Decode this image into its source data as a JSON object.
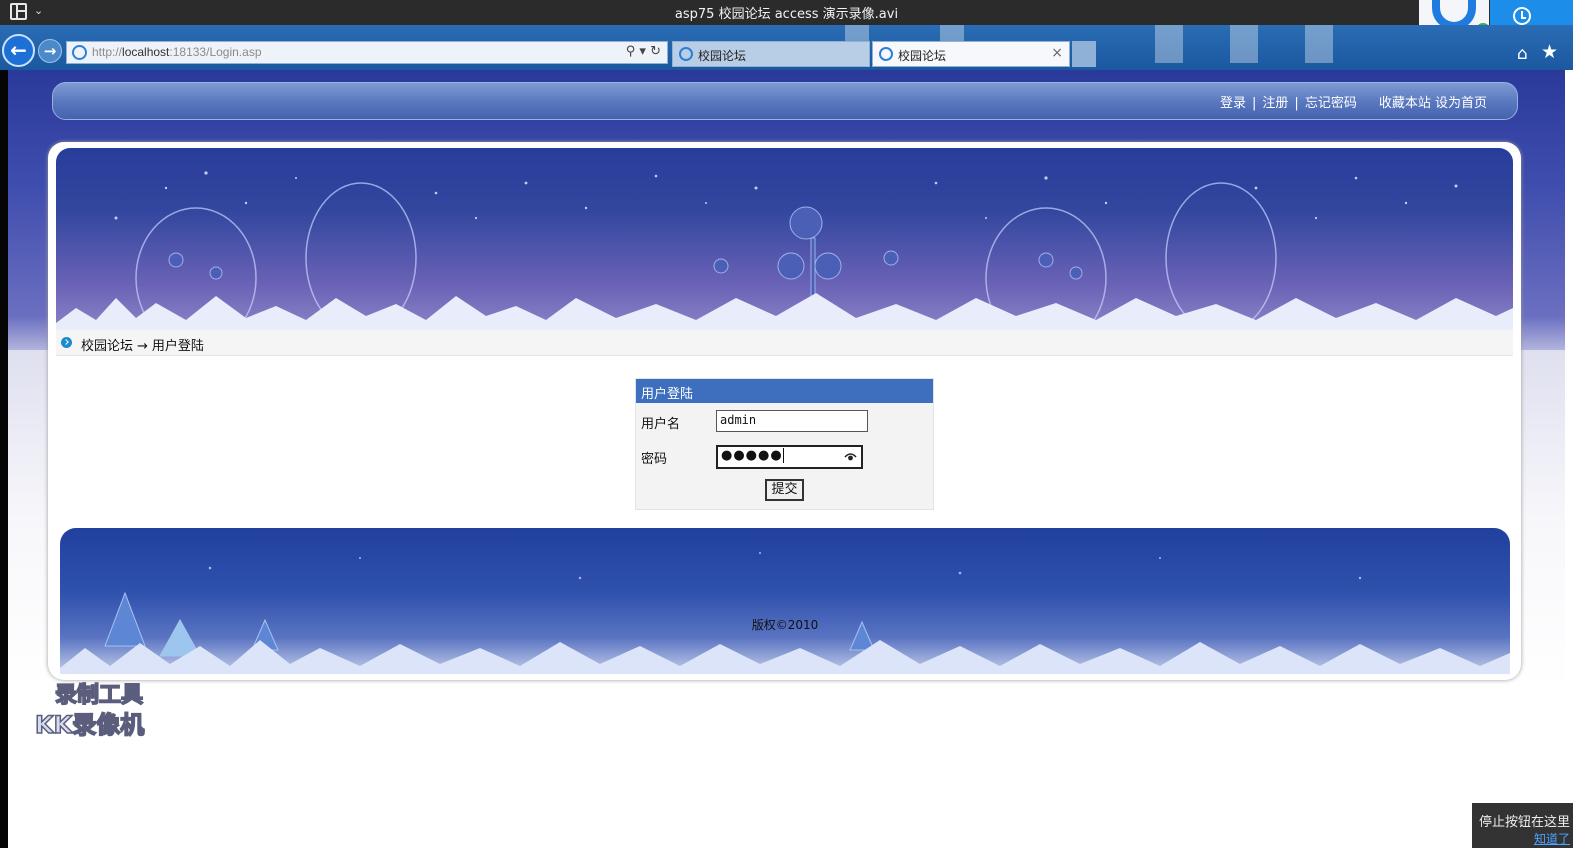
{
  "player": {
    "title": "asp75 校园论坛 access 演示录像.avi"
  },
  "browser": {
    "url_prefix": "http://",
    "url_host": "localhost",
    "url_rest": ":18133/Login.asp",
    "tabs": [
      {
        "label": "校园论坛"
      },
      {
        "label": "校园论坛"
      }
    ]
  },
  "top_nav": {
    "login": "登录",
    "register": "注册",
    "forgot_password": "忘记密码",
    "bookmark": "收藏本站",
    "set_homepage": "设为首页",
    "separator": "|"
  },
  "breadcrumb": {
    "home": "校园论坛",
    "arrow": "→",
    "current": "用户登陆"
  },
  "login_form": {
    "title": "用户登陆",
    "username_label": "用户名",
    "username_value": "admin",
    "password_label": "密码",
    "password_mask": "●●●●●",
    "submit_label": "提交"
  },
  "footer": {
    "copyright": "版权©2010"
  },
  "watermark": {
    "line1": "录制工具",
    "line2": "KK录像机"
  },
  "tooltip": {
    "text": "停止按钮在这里",
    "link": "知道了"
  },
  "colors": {
    "browser_chrome": "#1b58a0",
    "login_header": "#3e6fbf",
    "nav_bar": "#5b79c0"
  }
}
